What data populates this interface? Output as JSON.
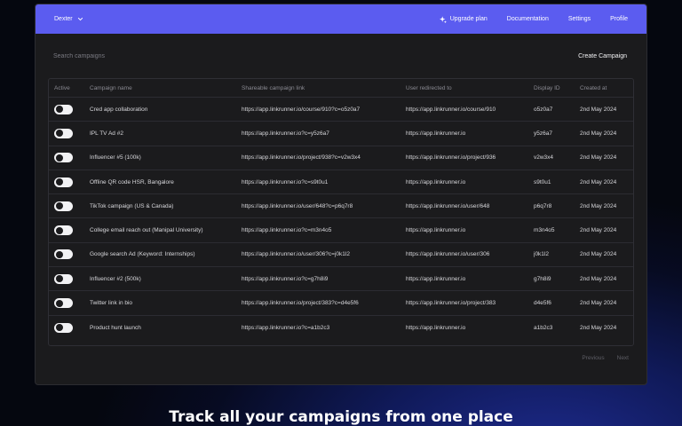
{
  "header": {
    "workspace": "Dexter",
    "nav": {
      "upgrade": "Upgrade plan",
      "documentation": "Documentation",
      "settings": "Settings",
      "profile": "Profile"
    }
  },
  "toolbar": {
    "search_placeholder": "Search campaigns",
    "create_label": "Create Campaign"
  },
  "table": {
    "columns": {
      "active": "Active",
      "name": "Campaign name",
      "link": "Shareable campaign link",
      "redirect": "User redirected to",
      "display_id": "Display ID",
      "created": "Created at"
    },
    "rows": [
      {
        "active": true,
        "name": "Cred app collaboration",
        "link": "https://app.linkrunner.io/course/910?c=o5z0a7",
        "redirect": "https://app.linkrunner.io/course/910",
        "display_id": "o5z0a7",
        "created": "2nd May 2024"
      },
      {
        "active": true,
        "name": "IPL TV Ad #2",
        "link": "https://app.linkrunner.io?c=y5z6a7",
        "redirect": "https://app.linkrunner.io",
        "display_id": "y5z6a7",
        "created": "2nd May 2024"
      },
      {
        "active": true,
        "name": "Influencer #5 (100k)",
        "link": "https://app.linkrunner.io/project/938?c=v2w3x4",
        "redirect": "https://app.linkrunner.io/project/936",
        "display_id": "v2w3x4",
        "created": "2nd May 2024"
      },
      {
        "active": true,
        "name": "Offline QR code HSR, Bangalore",
        "link": "https://app.linkrunner.io?c=s9t0u1",
        "redirect": "https://app.linkrunner.io",
        "display_id": "s9t0u1",
        "created": "2nd May 2024"
      },
      {
        "active": true,
        "name": "TikTok campaign (US & Canada)",
        "link": "https://app.linkrunner.io/user/648?c=p6q7r8",
        "redirect": "https://app.linkrunner.io/user/648",
        "display_id": "p6q7r8",
        "created": "2nd May 2024"
      },
      {
        "active": true,
        "name": "College email reach out (Manipal University)",
        "link": "https://app.linkrunner.io?c=m3n4o5",
        "redirect": "https://app.linkrunner.io",
        "display_id": "m3n4o5",
        "created": "2nd May 2024"
      },
      {
        "active": true,
        "name": "Google search Ad (Keyword: Internships)",
        "link": "https://app.linkrunner.io/user/306?c=j0k1l2",
        "redirect": "https://app.linkrunner.io/user/306",
        "display_id": "j0k1l2",
        "created": "2nd May 2024"
      },
      {
        "active": true,
        "name": "Influencer #2 (500k)",
        "link": "https://app.linkrunner.io?c=g7h8i9",
        "redirect": "https://app.linkrunner.io",
        "display_id": "g7h8i9",
        "created": "2nd May 2024"
      },
      {
        "active": true,
        "name": "Twitter link in bio",
        "link": "https://app.linkrunner.io/project/383?c=d4e5f6",
        "redirect": "https://app.linkrunner.io/project/383",
        "display_id": "d4e5f6",
        "created": "2nd May 2024"
      },
      {
        "active": true,
        "name": "Product hunt launch",
        "link": "https://app.linkrunner.io?c=a1b2c3",
        "redirect": "https://app.linkrunner.io",
        "display_id": "a1b2c3",
        "created": "2nd May 2024"
      }
    ]
  },
  "pagination": {
    "previous": "Previous",
    "next": "Next"
  },
  "tagline": "Track all your campaigns from one place",
  "colors": {
    "accent": "#5b5cf0",
    "panel": "#1b1b1d"
  }
}
